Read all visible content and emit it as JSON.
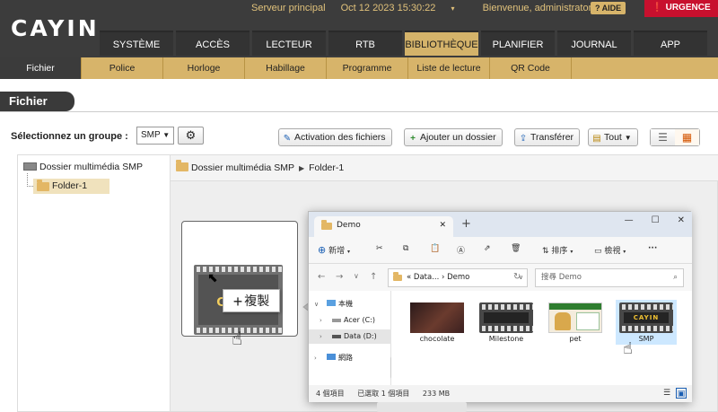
{
  "header": {
    "logo": "CAYIN",
    "server": "Serveur principal",
    "datetime": "Oct 12 2023 15:30:22",
    "welcome": "Bienvenue, administrator",
    "help": "AIDE",
    "urgent": "URGENCE",
    "caret": "▾"
  },
  "main_nav": [
    "SYSTÈME",
    "ACCÈS",
    "LECTEUR",
    "RTB",
    "BIBLIOTHÈQUE",
    "PLANIFIER",
    "JOURNAL",
    "APP"
  ],
  "main_nav_active": "BIBLIOTHÈQUE",
  "sub_nav": [
    "Fichier",
    "Police",
    "Horloge",
    "Habillage",
    "Programme",
    "Liste de lecture",
    "QR Code"
  ],
  "sub_nav_active": "Fichier",
  "page": {
    "title": "Fichier",
    "group_label": "Sélectionnez un groupe :",
    "group_value": "SMP"
  },
  "toolbar": {
    "activate": "Activation des fichiers",
    "add_folder": "Ajouter un dossier",
    "transfer": "Transférer",
    "filter": "Tout"
  },
  "tree": {
    "root": "Dossier multimédia SMP",
    "child": "Folder-1"
  },
  "breadcrumb": [
    "Dossier multimédia SMP",
    "Folder-1"
  ],
  "drag": {
    "thumb_brand": "CAYIN",
    "copy_tip": "複製"
  },
  "explorer": {
    "tab_title": "Demo",
    "new_tab": "+",
    "commands": {
      "new": "新增",
      "sort": "排序",
      "view": "檢視",
      "more": "···"
    },
    "address": [
      "Data...",
      "Demo"
    ],
    "address_prefix": "«",
    "search_placeholder": "搜尋 Demo",
    "sidebar": [
      {
        "label": "本機",
        "level": 0
      },
      {
        "label": "Acer (C:)",
        "level": 1
      },
      {
        "label": "Data (D:)",
        "level": 1,
        "selected": true
      },
      {
        "label": "網路",
        "level": 0
      }
    ],
    "files": [
      {
        "name": "chocolate",
        "kind": "image-chocolate"
      },
      {
        "name": "Milestone",
        "kind": "video"
      },
      {
        "name": "pet",
        "kind": "image-pet"
      },
      {
        "name": "SMP",
        "kind": "video-cayin",
        "selected": true,
        "brand": "CAYIN"
      }
    ],
    "status": {
      "count": "4 個項目",
      "selected": "已選取 1 個項目",
      "size": "233 MB"
    }
  },
  "colors": {
    "accent_gold": "#d7b46a",
    "header_dark": "#3c3c3c",
    "urgent_red": "#c8102e",
    "explorer_selection": "#cde8ff"
  }
}
